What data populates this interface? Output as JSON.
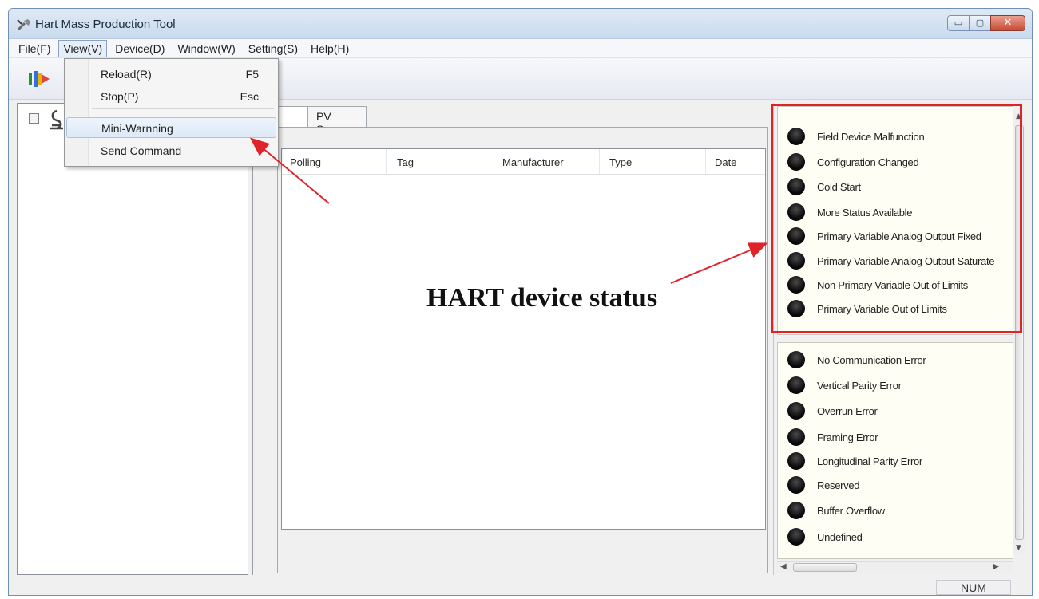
{
  "window": {
    "title": "Hart Mass Production Tool"
  },
  "title_buttons": {
    "minimize": "▭",
    "maximize": "▢",
    "close": "✕"
  },
  "menubar": {
    "items": [
      {
        "label": "File(F)"
      },
      {
        "label": "View(V)"
      },
      {
        "label": "Device(D)"
      },
      {
        "label": "Window(W)"
      },
      {
        "label": "Setting(S)"
      },
      {
        "label": "Help(H)"
      }
    ]
  },
  "view_menu": {
    "items": [
      {
        "label": "Reload(R)",
        "shortcut": "F5"
      },
      {
        "label": "Stop(P)",
        "shortcut": "Esc"
      },
      {
        "label": "Mini-Warnning",
        "shortcut": ""
      },
      {
        "label": "Send Command",
        "shortcut": ""
      }
    ],
    "highlighted": "Mini-Warnning"
  },
  "tabs": {
    "stub": "",
    "pv_scan": "PV Scan"
  },
  "device_list": {
    "columns": [
      "Polling",
      "Tag",
      "Manufacturer",
      "Type",
      "Date"
    ]
  },
  "device_status": {
    "items": [
      "Field Device Malfunction",
      "Configuration Changed",
      "Cold Start",
      "More Status Available",
      "Primary Variable Analog Output Fixed",
      "Primary Variable Analog Output Saturate",
      "Non Primary Variable Out of Limits",
      "Primary Variable Out of Limits"
    ]
  },
  "communication_status": {
    "items": [
      "No Communication Error",
      "Vertical Parity Error",
      "Overrun Error",
      "Framing Error",
      "Longitudinal Parity Error",
      "Reserved",
      "Buffer Overflow",
      "Undefined"
    ]
  },
  "scrollbars": {
    "up": "▲",
    "down": "▼",
    "left": "◀",
    "right": "▶",
    "grip": "III"
  },
  "statusbar": {
    "num": "NUM"
  },
  "annotation": {
    "text": "HART device status"
  },
  "colors": {
    "annotation_red": "#e0222a",
    "led": "#000000"
  },
  "icons": [
    "app-tool-icon",
    "run-icon",
    "device-tree-icon"
  ]
}
